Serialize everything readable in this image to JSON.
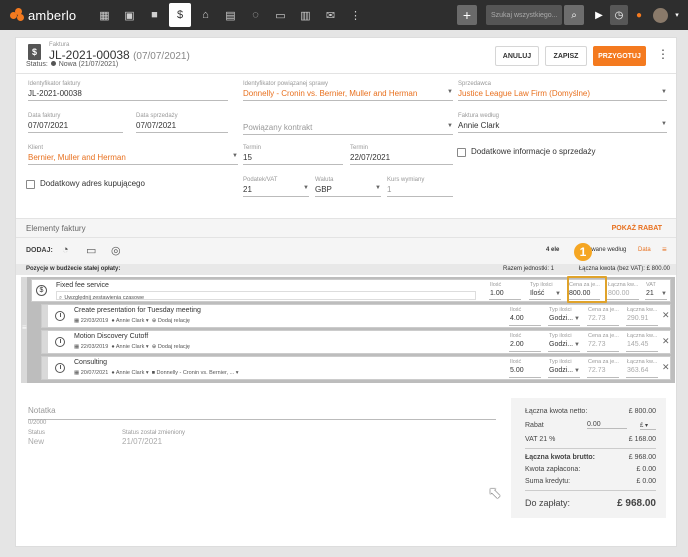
{
  "topbar": {
    "logo_text": "amberlo",
    "search_placeholder": "Szukaj wszystkiego...",
    "nav_icons": [
      "dashboard-icon",
      "contacts-icon",
      "matters-icon",
      "billing-icon",
      "bank-icon",
      "calendar-icon",
      "chat-icon",
      "folder-icon",
      "documents-icon",
      "mail-icon",
      "more-icon"
    ]
  },
  "header": {
    "label": "Faktura",
    "title": "JL-2021-00038",
    "date": "(07/07/2021)",
    "status_label": "Status:",
    "status_value": "Nowa (21/07/2021)",
    "cancel": "ANULUJ",
    "save": "ZAPISZ",
    "prepare": "PRZYGOTUJ"
  },
  "form": {
    "invoice_id_label": "Identyfikator faktury",
    "invoice_id": "JL-2021-00038",
    "matter_label": "Identyfikator powiązanej sprawy",
    "matter": "Donnelly - Cronin vs. Bernier, Muller and Herman",
    "seller_label": "Sprzedawca",
    "seller": "Justice League Law Firm (Domyślne)",
    "invoice_date_label": "Data faktury",
    "invoice_date": "07/07/2021",
    "sale_date_label": "Data sprzedaży",
    "sale_date": "07/07/2021",
    "contract_placeholder": "Powiązany kontrakt",
    "invoiced_by_label": "Faktura według",
    "invoiced_by": "Annie Clark",
    "client_label": "Klient",
    "client": "Bernier, Muller and Herman",
    "term_label": "Termin",
    "term": "15",
    "term_date_label": "Termin",
    "term_date": "22/07/2021",
    "extra_sale_info": "Dodatkowe informacje o sprzedaży",
    "extra_buyer_address": "Dodatkowy adres kupującego",
    "vat_label": "Podatek/VAT",
    "vat": "21",
    "currency_label": "Waluta",
    "currency": "GBP",
    "rate_label": "Kurs wymiany",
    "rate": "1"
  },
  "items": {
    "section_title": "Elementy faktury",
    "show_discount": "POKAŻ RABAT",
    "add_label": "DODAJ:",
    "add_icons": [
      "add-time-icon",
      "add-expense-icon",
      "add-fixed-fee-icon"
    ],
    "count_prefix": "4 ele",
    "sort_text": "sortowane według",
    "sort_value": "Data",
    "budget_header": "Pozycje w budżecie stałej opłaty:",
    "total_units": "Razem jednostki:  1",
    "total_net": "Łączna kwota (bez VAT): £ 800.00",
    "fixed": {
      "title": "Fixed fee service",
      "sub": "Uwzględnij zestawienia czasowe",
      "qty_label": "Ilość",
      "qty": "1.00",
      "unit_type_label": "Typ ilości",
      "unit_type": "Ilość",
      "price_label": "Cena za je...",
      "price": "800.00",
      "total_label": "Łączna kw...",
      "total": "800.00",
      "vat_label": "VAT",
      "vat": "21"
    },
    "entries": [
      {
        "title": "Create presentation for Tuesday meeting",
        "date": "22/03/2019",
        "user": "Annie Clark",
        "extra": "Dodaj relację",
        "qty_label": "Ilość",
        "qty": "4.00",
        "type_label": "Typ ilości",
        "type": "Godzi...",
        "price_label": "Cena za je...",
        "price": "72.73",
        "total_label": "Łączna kw...",
        "total": "290.91"
      },
      {
        "title": "Motion Discovery Cutoff",
        "date": "22/03/2019",
        "user": "Annie Clark",
        "extra": "Dodaj relację",
        "qty_label": "Ilość",
        "qty": "2.00",
        "type_label": "Typ ilości",
        "type": "Godzi...",
        "price_label": "Cena za je...",
        "price": "72.73",
        "total_label": "Łączna kw...",
        "total": "145.45"
      },
      {
        "title": "Consulting",
        "date": "20/07/2021",
        "user": "Annie Clark",
        "extra": "Donnelly - Cronin vs. Bernier, ...",
        "qty_label": "Ilość",
        "qty": "5.00",
        "type_label": "Typ ilości",
        "type": "Godzi...",
        "price_label": "Cena za je...",
        "price": "72.73",
        "total_label": "Łączna kw...",
        "total": "363.64"
      }
    ],
    "badge": "1"
  },
  "notes": {
    "label": "Notatka",
    "counter": "0/2000",
    "status_label": "Status",
    "status": "New",
    "changed_label": "Status został zmieniony",
    "changed": "21/07/2021"
  },
  "summary": {
    "net_label": "Łączna kwota netto:",
    "net": "£ 800.00",
    "discount_label": "Rabat",
    "discount": "0.00",
    "discount_unit": "£",
    "vat_label": "VAT 21 %",
    "vat": "£ 168.00",
    "gross_label": "Łączna kwota brutto:",
    "gross": "£ 968.00",
    "paid_label": "Kwota zapłacona:",
    "paid": "£ 0.00",
    "credit_label": "Suma kredytu:",
    "credit": "£ 0.00",
    "due_label": "Do zapłaty:",
    "due": "£ 968.00"
  },
  "colors": {
    "accent": "#f47a1f",
    "topbar": "#2e2e2e",
    "highlight": "#e0a32a"
  }
}
